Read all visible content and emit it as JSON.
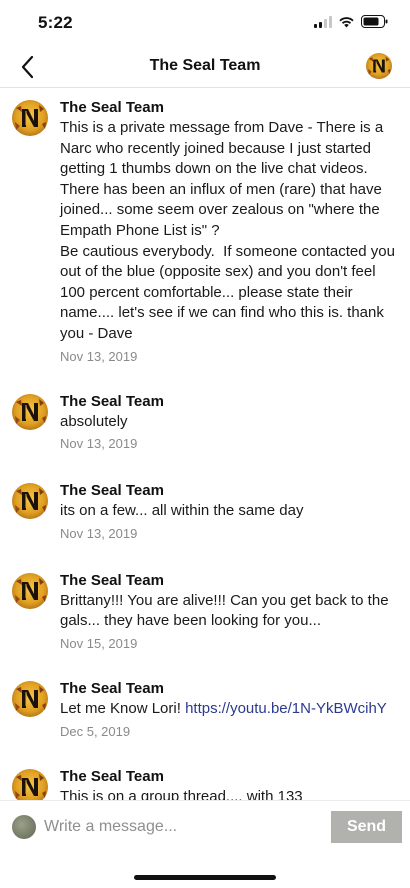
{
  "status_bar": {
    "time": "5:22"
  },
  "header": {
    "title": "The Seal Team"
  },
  "messages": [
    {
      "sender": "The Seal Team",
      "text": "This is a private message from Dave - There is a Narc who recently joined because I just started getting 1 thumbs down on the live chat videos. There has been an influx of men (rare) that have joined... some seem over zealous on \"where the Empath Phone List is\" ?\nBe cautious everybody.  If someone contacted you out of the blue (opposite sex) and you don't feel 100 percent comfortable... please state their name.... let's see if we can find who this is. thank you - Dave",
      "date": "Nov 13, 2019"
    },
    {
      "sender": "The Seal Team",
      "text": "absolutely",
      "date": "Nov 13, 2019"
    },
    {
      "sender": "The Seal Team",
      "text": "its on a few... all within the same day",
      "date": "Nov 13, 2019"
    },
    {
      "sender": "The Seal Team",
      "text": "Brittany!!! You are alive!!! Can you get back to the gals... they have been looking for you...",
      "date": "Nov 15, 2019"
    },
    {
      "sender": "The Seal Team",
      "text": "Let me Know Lori! ",
      "link": "https://youtu.be/1N-YkBWcihY",
      "date": "Dec 5, 2019"
    },
    {
      "sender": "The Seal Team",
      "text": "This is on a group thread.... with 133",
      "date": ""
    }
  ],
  "composer": {
    "placeholder": "Write a message...",
    "send_label": "Send"
  },
  "colors": {
    "link": "#2b3a8f",
    "send_button": "#b1b1ad",
    "date_text": "#8a8a8a"
  },
  "icons": {
    "back": "chevron-left-icon",
    "group": "group-logo-avatar",
    "signal": "cellular-signal-icon",
    "wifi": "wifi-icon",
    "battery": "battery-icon"
  }
}
